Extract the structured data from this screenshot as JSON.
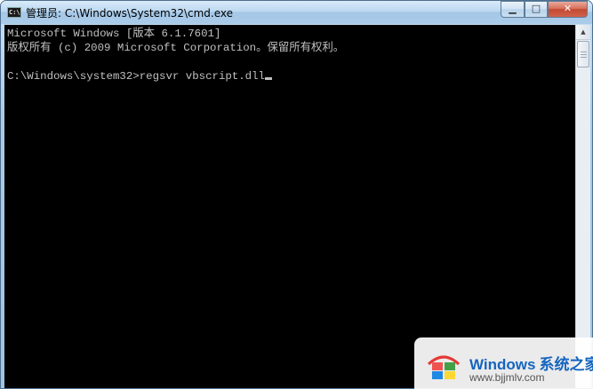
{
  "window": {
    "title": "管理员: C:\\Windows\\System32\\cmd.exe",
    "icon": "cmd-icon",
    "controls": {
      "minimize": "▁",
      "maximize": "□",
      "close": "✕"
    }
  },
  "console": {
    "lines": [
      "Microsoft Windows [版本 6.1.7601]",
      "版权所有 (c) 2009 Microsoft Corporation。保留所有权利。",
      "",
      "C:\\Windows\\system32>regsvr vbscript.dll"
    ],
    "text_color": "#c0c0c0",
    "background": "#000000"
  },
  "scrollbar": {
    "up_arrow": "▲"
  },
  "watermark": {
    "title": "Windows",
    "title_cn": "系统之家",
    "url": "www.bjjmlv.com",
    "accent": "#1565c0"
  }
}
